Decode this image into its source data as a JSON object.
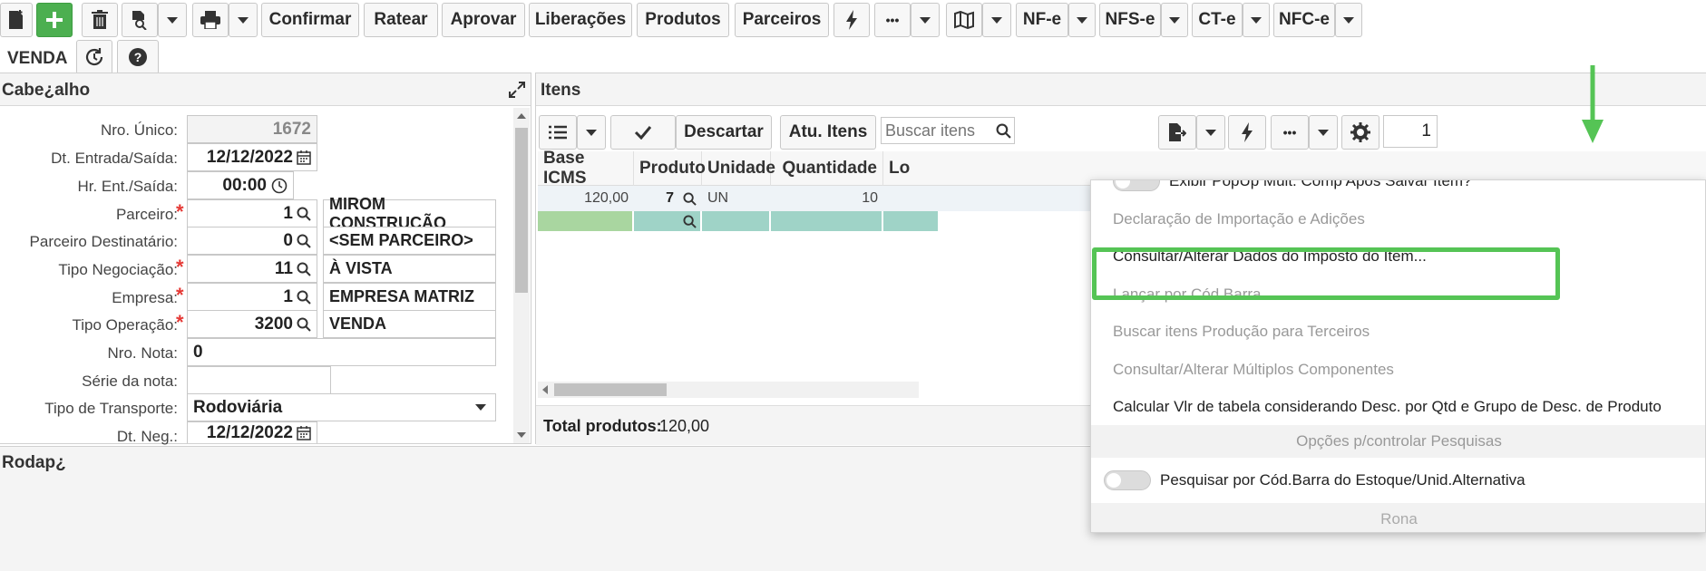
{
  "toolbar": {
    "confirmar": "Confirmar",
    "ratear": "Ratear",
    "aprovar": "Aprovar",
    "liberacoes": "Liberações",
    "produtos": "Produtos",
    "parceiros": "Parceiros",
    "nfe": "NF-e",
    "nfse": "NFS-e",
    "cte": "CT-e",
    "nfce": "NFC-e",
    "mode": "VENDA",
    "more": "•••"
  },
  "header_panel": {
    "title": "Cabe¿alho",
    "fields": {
      "nro_unico": {
        "label": "Nro. Único:",
        "value": "1672"
      },
      "dt_entrada": {
        "label": "Dt. Entrada/Saída:",
        "value": "12/12/2022"
      },
      "hr_ent": {
        "label": "Hr. Ent./Saída:",
        "value": "00:00"
      },
      "parceiro": {
        "label": "Parceiro:",
        "value": "1",
        "desc": "MIROM CONSTRUÇÃO"
      },
      "parceiro_dest": {
        "label": "Parceiro Destinatário:",
        "value": "0",
        "desc": "<SEM PARCEIRO>"
      },
      "tipo_neg": {
        "label": "Tipo Negociação:",
        "value": "11",
        "desc": "À VISTA"
      },
      "empresa": {
        "label": "Empresa:",
        "value": "1",
        "desc": "EMPRESA MATRIZ"
      },
      "tipo_op": {
        "label": "Tipo Operação:",
        "value": "3200",
        "desc": "VENDA"
      },
      "nro_nota": {
        "label": "Nro. Nota:",
        "value": "0"
      },
      "serie": {
        "label": "Série da nota:",
        "value": ""
      },
      "tipo_transp": {
        "label": "Tipo de Transporte:",
        "value": "Rodoviária"
      },
      "dt_neg": {
        "label": "Dt. Neg.:",
        "value": "12/12/2022"
      }
    }
  },
  "items_panel": {
    "title": "Itens",
    "descartar": "Descartar",
    "atu_itens": "Atu. Itens",
    "search_placeholder": "Buscar itens",
    "page": "1",
    "columns": [
      "Base ICMS",
      "Produto",
      "Unidade",
      "Quantidade",
      "Lo"
    ],
    "row": {
      "base_icms": "120,00",
      "produto": "7",
      "unidade": "UN",
      "quantidade": "10"
    },
    "total_label": "Total produtos:",
    "total_value": "120,00"
  },
  "dropdown": {
    "items": [
      {
        "label": "Exibir PopUp Mult. Comp Apos Salvar Item?",
        "type": "toggle"
      },
      {
        "label": "Declaração de Importação e Adições",
        "type": "disabled"
      },
      {
        "label": "Consultar/Alterar Dados do Imposto do Item...",
        "type": "highlighted"
      },
      {
        "label": "Lançar por Cód.Barra",
        "type": "disabled"
      },
      {
        "label": "Buscar itens Produção para Terceiros",
        "type": "disabled"
      },
      {
        "label": "Consultar/Alterar Múltiplos Componentes",
        "type": "disabled"
      },
      {
        "label": "Calcular Vlr de tabela considerando Desc. por Qtd e Grupo de Desc. de Produto",
        "type": "normal"
      }
    ],
    "section_title": "Opções p/controlar Pesquisas",
    "toggle_item": "Pesquisar por Cód.Barra do Estoque/Unid.Alternativa",
    "section_cut": "Rona"
  },
  "footer_panel": {
    "title": "Rodap¿"
  },
  "colors": {
    "accent_green": "#5cc85c",
    "highlight_green": "#55c455",
    "toolbar_green": "#4caf50"
  }
}
